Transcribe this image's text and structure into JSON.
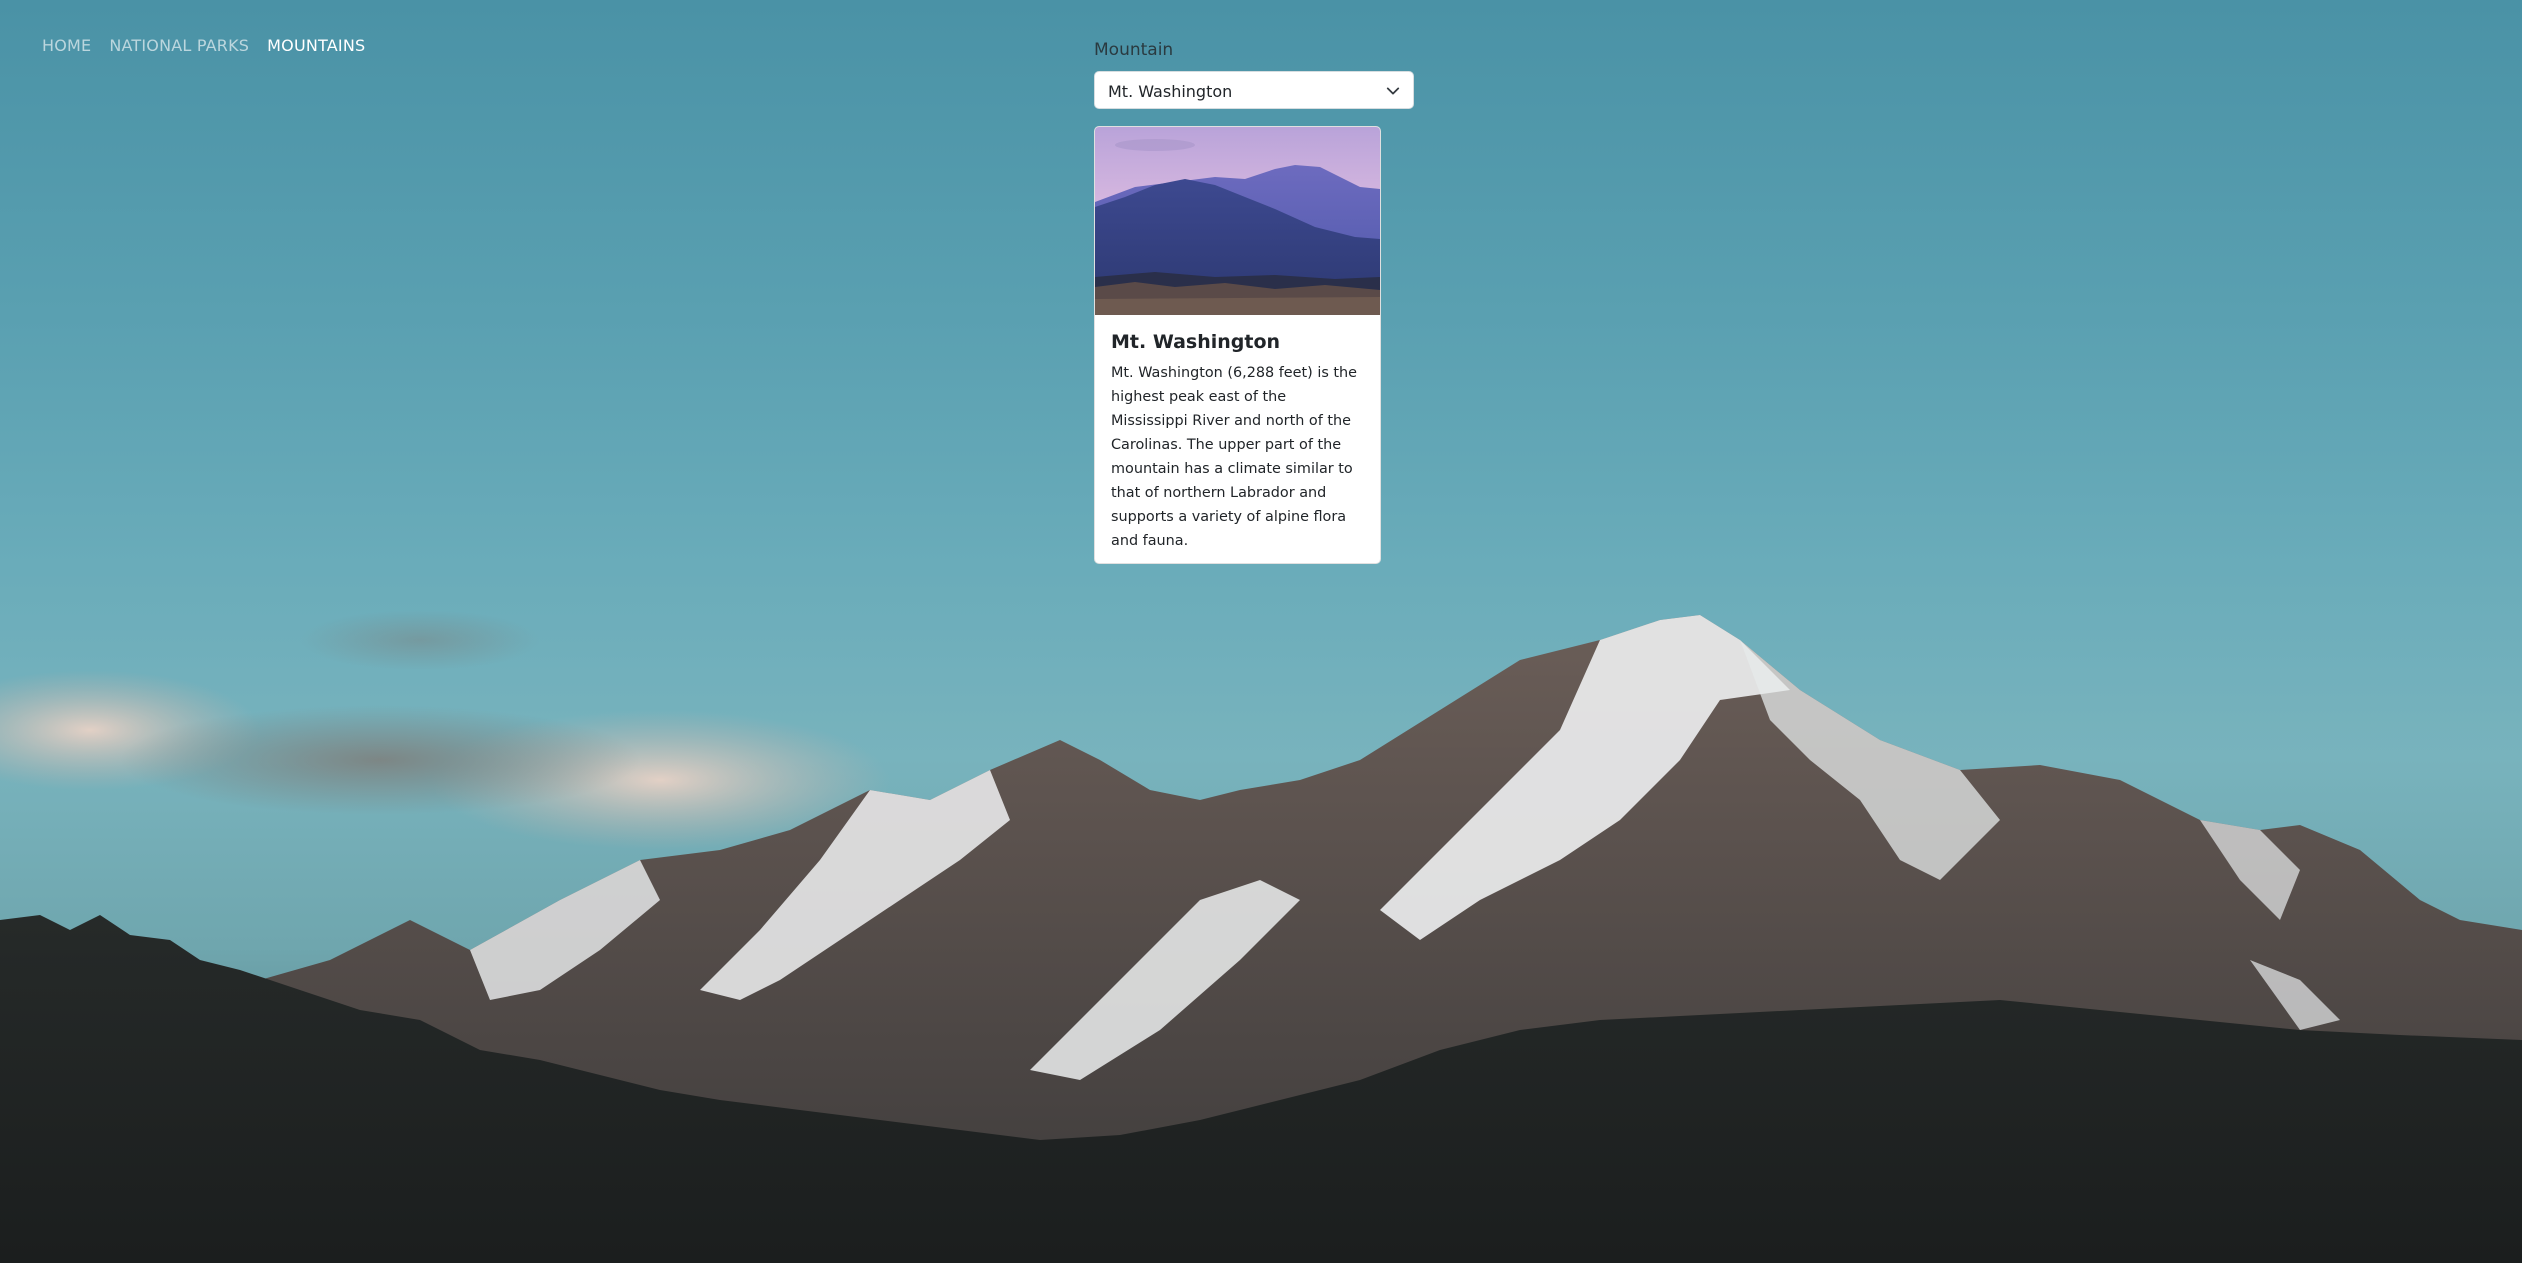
{
  "nav": {
    "items": [
      {
        "label": "HOME",
        "active": false
      },
      {
        "label": "NATIONAL PARKS",
        "active": false
      },
      {
        "label": "MOUNTAINS",
        "active": true
      }
    ]
  },
  "selector": {
    "label": "Mountain",
    "selected": "Mt. Washington",
    "icon": "chevron-down-icon"
  },
  "card": {
    "image_subject": "mountain-range-at-dusk-photo",
    "title": "Mt. Washington",
    "description": "Mt. Washington (6,288 feet) is the highest peak east of the Mississippi River and north of the Carolinas. The upper part of the mountain has a climate similar to that of northern Labrador and supports a variety of alpine flora and fauna."
  },
  "background": {
    "subject": "snow-capped-mountain-photo"
  },
  "colors": {
    "sky": "#5aa0b1",
    "nav_active": "#ffffff",
    "card_bg": "#ffffff",
    "text": "#212529"
  }
}
